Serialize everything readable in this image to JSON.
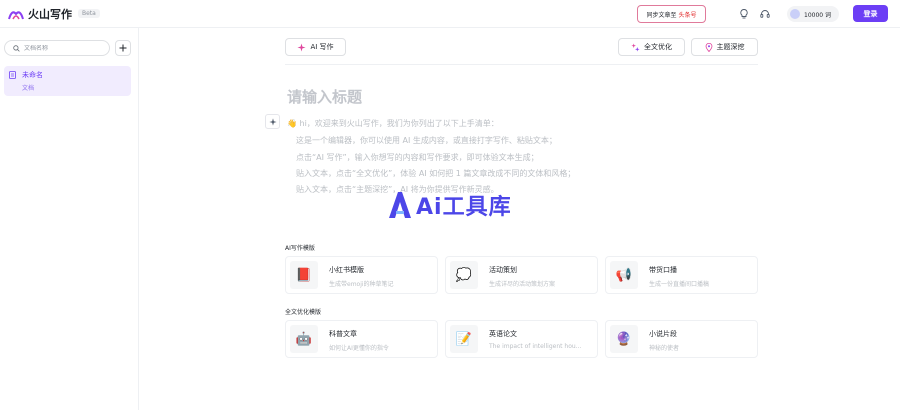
{
  "header": {
    "app_name": "火山写作",
    "beta_badge": "Beta",
    "sync_prefix": "同步文章至",
    "sync_target": "头条号",
    "credits": "10000 词",
    "login_label": "登录",
    "colors": {
      "accent": "#6c3ef5",
      "sync_target": "#e02020",
      "sync_border": "#e07a9b"
    }
  },
  "sidebar": {
    "search_placeholder": "文档名称",
    "add_icon": "plus-icon",
    "documents": [
      {
        "title": "未命名",
        "subtitle": "文档"
      }
    ]
  },
  "toolbar": {
    "ai_write": "AI 写作",
    "full_optimize": "全文优化",
    "topic_explore": "主题深挖"
  },
  "editor": {
    "title_placeholder": "请输入标题",
    "intro_lines": [
      "👋 hi，欢迎来到火山写作，我们为你列出了以下上手清单：",
      "这是一个编辑器，你可以使用 AI 生成内容，或直接打字写作、粘贴文本；",
      "点击“AI 写作”，输入你想写的内容和写作要求，即可体验文本生成；",
      "贴入文本，点击“全文优化”，体验 AI 如何把 1 篇文章改成不同的文体和风格；",
      "贴入文本，点击“主题深挖”，AI 将为你提供写作新灵感。"
    ],
    "watermark": "Ai工具库"
  },
  "templates": {
    "ai_section_label": "AI写作模版",
    "ai_cards": [
      {
        "icon": "📕",
        "title": "小红书模版",
        "desc": "生成带emoji的种草笔记"
      },
      {
        "icon": "💭",
        "title": "活动策划",
        "desc": "生成详尽的活动策划方案"
      },
      {
        "icon": "📢",
        "title": "带货口播",
        "desc": "生成一份直播间口播稿"
      }
    ],
    "opt_section_label": "全文优化模版",
    "opt_cards": [
      {
        "icon": "🤖",
        "title": "科普文章",
        "desc": "如何让AI更懂你的指令"
      },
      {
        "icon": "📝",
        "title": "英语论文",
        "desc": "The impact of intelligent hou..."
      },
      {
        "icon": "🔮",
        "title": "小说片段",
        "desc": "神秘的使者"
      }
    ]
  }
}
